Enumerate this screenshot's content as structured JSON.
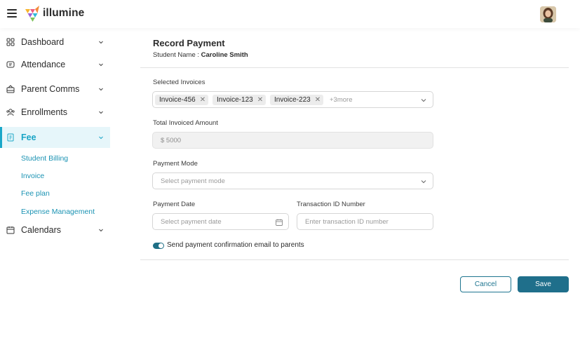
{
  "header": {
    "app_name": "illumine",
    "menu_icon": "hamburger-icon",
    "avatar": "user-avatar"
  },
  "sidebar": {
    "items": [
      {
        "label": "Dashboard",
        "icon": "dashboard-icon"
      },
      {
        "label": "Attendance",
        "icon": "attendance-icon"
      },
      {
        "label": "Parent Comms",
        "icon": "parent-comms-icon"
      },
      {
        "label": "Enrollments",
        "icon": "enrollments-icon"
      },
      {
        "label": "Fee",
        "icon": "fee-icon",
        "active": true
      },
      {
        "label": "Calendars",
        "icon": "calendar-icon"
      }
    ],
    "fee_subitems": [
      "Student Billing",
      "Invoice",
      "Fee plan",
      "Expense Management"
    ]
  },
  "form": {
    "title": "Record Payment",
    "student_prefix": "Student Name : ",
    "student_name": "Caroline Smith",
    "selected_invoices_label": "Selected Invoices",
    "invoices": [
      "Invoice-456",
      "Invoice-123",
      "Invoice-223"
    ],
    "more_text": "+3more",
    "total_label": "Total Invoiced Amount",
    "total_value": "$ 5000",
    "payment_mode_label": "Payment Mode",
    "payment_mode_placeholder": "Select payment mode",
    "payment_date_label": "Payment Date",
    "payment_date_placeholder": "Select payment date",
    "transaction_label": "Transaction ID Number",
    "transaction_placeholder": "Enter transaction ID number",
    "email_toggle_label": "Send payment confirmation email to parents",
    "email_toggle_on": true,
    "cancel_label": "Cancel",
    "save_label": "Save"
  },
  "colors": {
    "accent": "#1aa5c6",
    "primary_button": "#1f6f8b",
    "active_bg": "#e6f6fa"
  }
}
